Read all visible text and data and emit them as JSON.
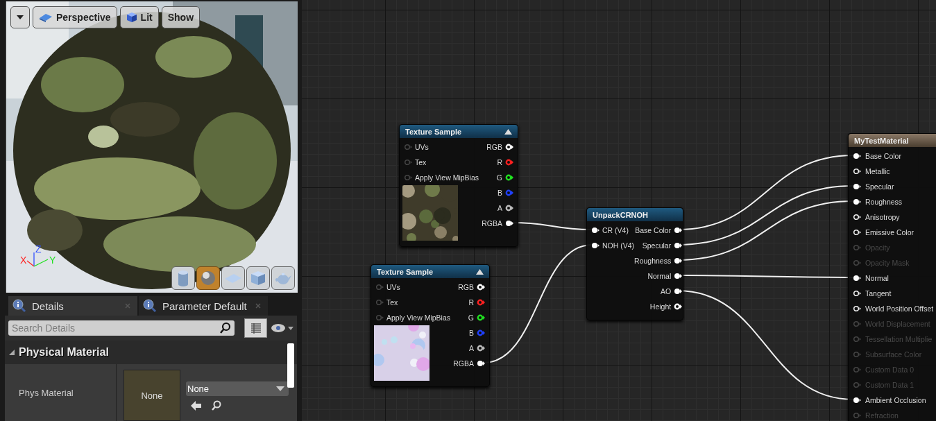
{
  "viewport": {
    "toolbar": [
      {
        "kind": "menu"
      },
      {
        "kind": "view",
        "label": "Perspective"
      },
      {
        "kind": "lighting",
        "label": "Lit"
      },
      {
        "kind": "plain",
        "label": "Show"
      }
    ],
    "axes": [
      {
        "label": "X",
        "color": "#ff2020"
      },
      {
        "label": "Z",
        "color": "#3050ff"
      },
      {
        "label": "Y",
        "color": "#20e020"
      }
    ],
    "preview_shapes": [
      {
        "kind": "cylinder",
        "selected": false
      },
      {
        "kind": "sphere",
        "selected": true
      },
      {
        "kind": "plane",
        "selected": false
      },
      {
        "kind": "cube",
        "selected": false
      },
      {
        "kind": "teapot",
        "selected": false
      }
    ]
  },
  "details": {
    "tabs": [
      {
        "label": "Details",
        "selected": true
      },
      {
        "label": "Parameter Default",
        "selected": false
      }
    ],
    "search": {
      "placeholder": "Search Details"
    },
    "category": {
      "label": "Physical Material",
      "expanded": true
    },
    "property": {
      "label": "Phys Material",
      "thumbnail": "None",
      "value": "None"
    }
  },
  "graph": {
    "nodes": [
      {
        "kind": "texture",
        "title": "Texture Sample",
        "inputs": [
          {
            "label": "UVs",
            "connected": false
          },
          {
            "label": "Tex",
            "connected": false
          },
          {
            "label": "Apply View MipBias",
            "connected": false
          }
        ],
        "outputs": [
          {
            "label": "RGB",
            "color": "#ffffff",
            "connected": false
          },
          {
            "label": "R",
            "color": "#ff2020",
            "connected": false
          },
          {
            "label": "G",
            "color": "#20e020",
            "connected": false
          },
          {
            "label": "B",
            "color": "#2040ff",
            "connected": false
          },
          {
            "label": "A",
            "color": "#bbbbbb",
            "connected": false
          },
          {
            "label": "RGBA",
            "color": "#ffffff",
            "connected": true
          }
        ]
      },
      {
        "kind": "texture",
        "title": "Texture Sample",
        "inputs": [
          {
            "label": "UVs",
            "connected": false
          },
          {
            "label": "Tex",
            "connected": false
          },
          {
            "label": "Apply View MipBias",
            "connected": false
          }
        ],
        "outputs": [
          {
            "label": "RGB",
            "color": "#ffffff",
            "connected": false
          },
          {
            "label": "R",
            "color": "#ff2020",
            "connected": false
          },
          {
            "label": "G",
            "color": "#20e020",
            "connected": false
          },
          {
            "label": "B",
            "color": "#2040ff",
            "connected": false
          },
          {
            "label": "A",
            "color": "#bbbbbb",
            "connected": false
          },
          {
            "label": "RGBA",
            "color": "#ffffff",
            "connected": true
          }
        ]
      },
      {
        "kind": "function",
        "title": "UnpackCRNOH",
        "inputs": [
          {
            "label": "CR (V4)",
            "connected": true
          },
          {
            "label": "NOH (V4)",
            "connected": true
          }
        ],
        "outputs": [
          {
            "label": "Base Color",
            "color": "#ffffff",
            "connected": true
          },
          {
            "label": "Specular",
            "color": "#ffffff",
            "connected": true
          },
          {
            "label": "Roughness",
            "color": "#ffffff",
            "connected": true
          },
          {
            "label": "Normal",
            "color": "#ffffff",
            "connected": true
          },
          {
            "label": "AO",
            "color": "#ffffff",
            "connected": true
          },
          {
            "label": "Height",
            "color": "#ffffff",
            "connected": false
          }
        ]
      },
      {
        "kind": "result",
        "title": "MyTestMaterial",
        "inputs": [
          {
            "label": "Base Color",
            "connected": true,
            "disabled": false
          },
          {
            "label": "Metallic",
            "connected": false,
            "disabled": false
          },
          {
            "label": "Specular",
            "connected": true,
            "disabled": false
          },
          {
            "label": "Roughness",
            "connected": true,
            "disabled": false
          },
          {
            "label": "Anisotropy",
            "connected": false,
            "disabled": false
          },
          {
            "label": "Emissive Color",
            "connected": false,
            "disabled": false
          },
          {
            "label": "Opacity",
            "connected": false,
            "disabled": true
          },
          {
            "label": "Opacity Mask",
            "connected": false,
            "disabled": true
          },
          {
            "label": "Normal",
            "connected": true,
            "disabled": false
          },
          {
            "label": "Tangent",
            "connected": false,
            "disabled": false
          },
          {
            "label": "World Position Offset",
            "connected": false,
            "disabled": false
          },
          {
            "label": "World Displacement",
            "connected": false,
            "disabled": true
          },
          {
            "label": "Tessellation Multiplie",
            "connected": false,
            "disabled": true
          },
          {
            "label": "Subsurface Color",
            "connected": false,
            "disabled": true
          },
          {
            "label": "Custom Data 0",
            "connected": false,
            "disabled": true
          },
          {
            "label": "Custom Data 1",
            "connected": false,
            "disabled": true
          },
          {
            "label": "Ambient Occlusion",
            "connected": true,
            "disabled": false
          },
          {
            "label": "Refraction",
            "connected": false,
            "disabled": true
          }
        ]
      }
    ]
  }
}
